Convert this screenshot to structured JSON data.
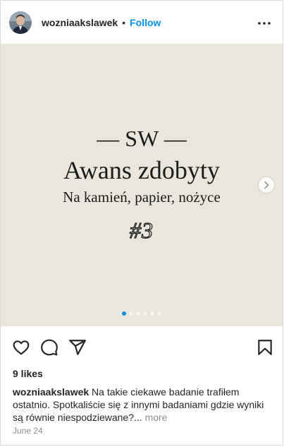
{
  "post": {
    "username": "wozniaakslawek",
    "separator": "•",
    "follow_label": "Follow",
    "more_icon": "more-horizontal-icon"
  },
  "slide": {
    "line1": "— SW —",
    "title": "Awans zdobyty",
    "subtitle": "Na kamień, papier, nożyce",
    "number": "#3",
    "background_color": "#e9e6dc",
    "dots_total": 6,
    "dots_active": 1
  },
  "actions": {
    "like_icon": "heart-icon",
    "comment_icon": "comment-icon",
    "share_icon": "send-icon",
    "save_icon": "bookmark-icon"
  },
  "likes": "9 likes",
  "caption": {
    "username": "wozniaakslawek",
    "text": " Na takie ciekawe badanie trafiłem ostatnio. Spotkaliście się z innymi badaniami gdzie wyniki są równie niespodziewane?... ",
    "more_label": "more"
  },
  "date": "June 24",
  "colors": {
    "accent": "#0095f6",
    "muted": "#8e8e8e",
    "text": "#262626"
  }
}
